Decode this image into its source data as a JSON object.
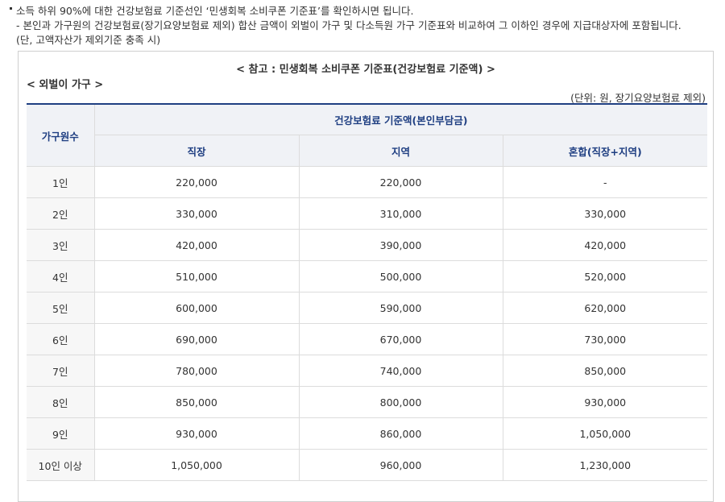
{
  "intro": {
    "line1": "소득 하위 90%에 대한 건강보험료 기준선인 ‘민생회복 소비쿠폰 기준표’를 확인하시면 됩니다.",
    "line2": "- 본인과 가구원의 건강보험료(장기요양보험료 제외) 합산 금액이 외벌이 가구 및 다소득원 가구 기준표와 비교하여 그 이하인 경우에 지급대상자에 포함됩니다.",
    "line3": "(단, 고액자산가 제외기준 충족 시)"
  },
  "reference": {
    "title": "< 참고 : 민생회복 소비쿠폰 기준표(건강보험료 기준액) >",
    "subtitle": "< 외벌이 가구 >",
    "unit": "(단위: 원, 장기요양보험료 제외)"
  },
  "table": {
    "headers": {
      "household_size": "가구원수",
      "group": "건강보험료 기준액(본인부담금)",
      "workplace": "직장",
      "regional": "지역",
      "mixed": "혼합(직장+지역)"
    },
    "rows": [
      {
        "size": "1인",
        "workplace": "220,000",
        "regional": "220,000",
        "mixed": "-"
      },
      {
        "size": "2인",
        "workplace": "330,000",
        "regional": "310,000",
        "mixed": "330,000"
      },
      {
        "size": "3인",
        "workplace": "420,000",
        "regional": "390,000",
        "mixed": "420,000"
      },
      {
        "size": "4인",
        "workplace": "510,000",
        "regional": "500,000",
        "mixed": "520,000"
      },
      {
        "size": "5인",
        "workplace": "600,000",
        "regional": "590,000",
        "mixed": "620,000"
      },
      {
        "size": "6인",
        "workplace": "690,000",
        "regional": "670,000",
        "mixed": "730,000"
      },
      {
        "size": "7인",
        "workplace": "780,000",
        "regional": "740,000",
        "mixed": "850,000"
      },
      {
        "size": "8인",
        "workplace": "850,000",
        "regional": "800,000",
        "mixed": "930,000"
      },
      {
        "size": "9인",
        "workplace": "930,000",
        "regional": "860,000",
        "mixed": "1,050,000"
      },
      {
        "size": "10인 이상",
        "workplace": "1,050,000",
        "regional": "960,000",
        "mixed": "1,230,000"
      }
    ]
  }
}
